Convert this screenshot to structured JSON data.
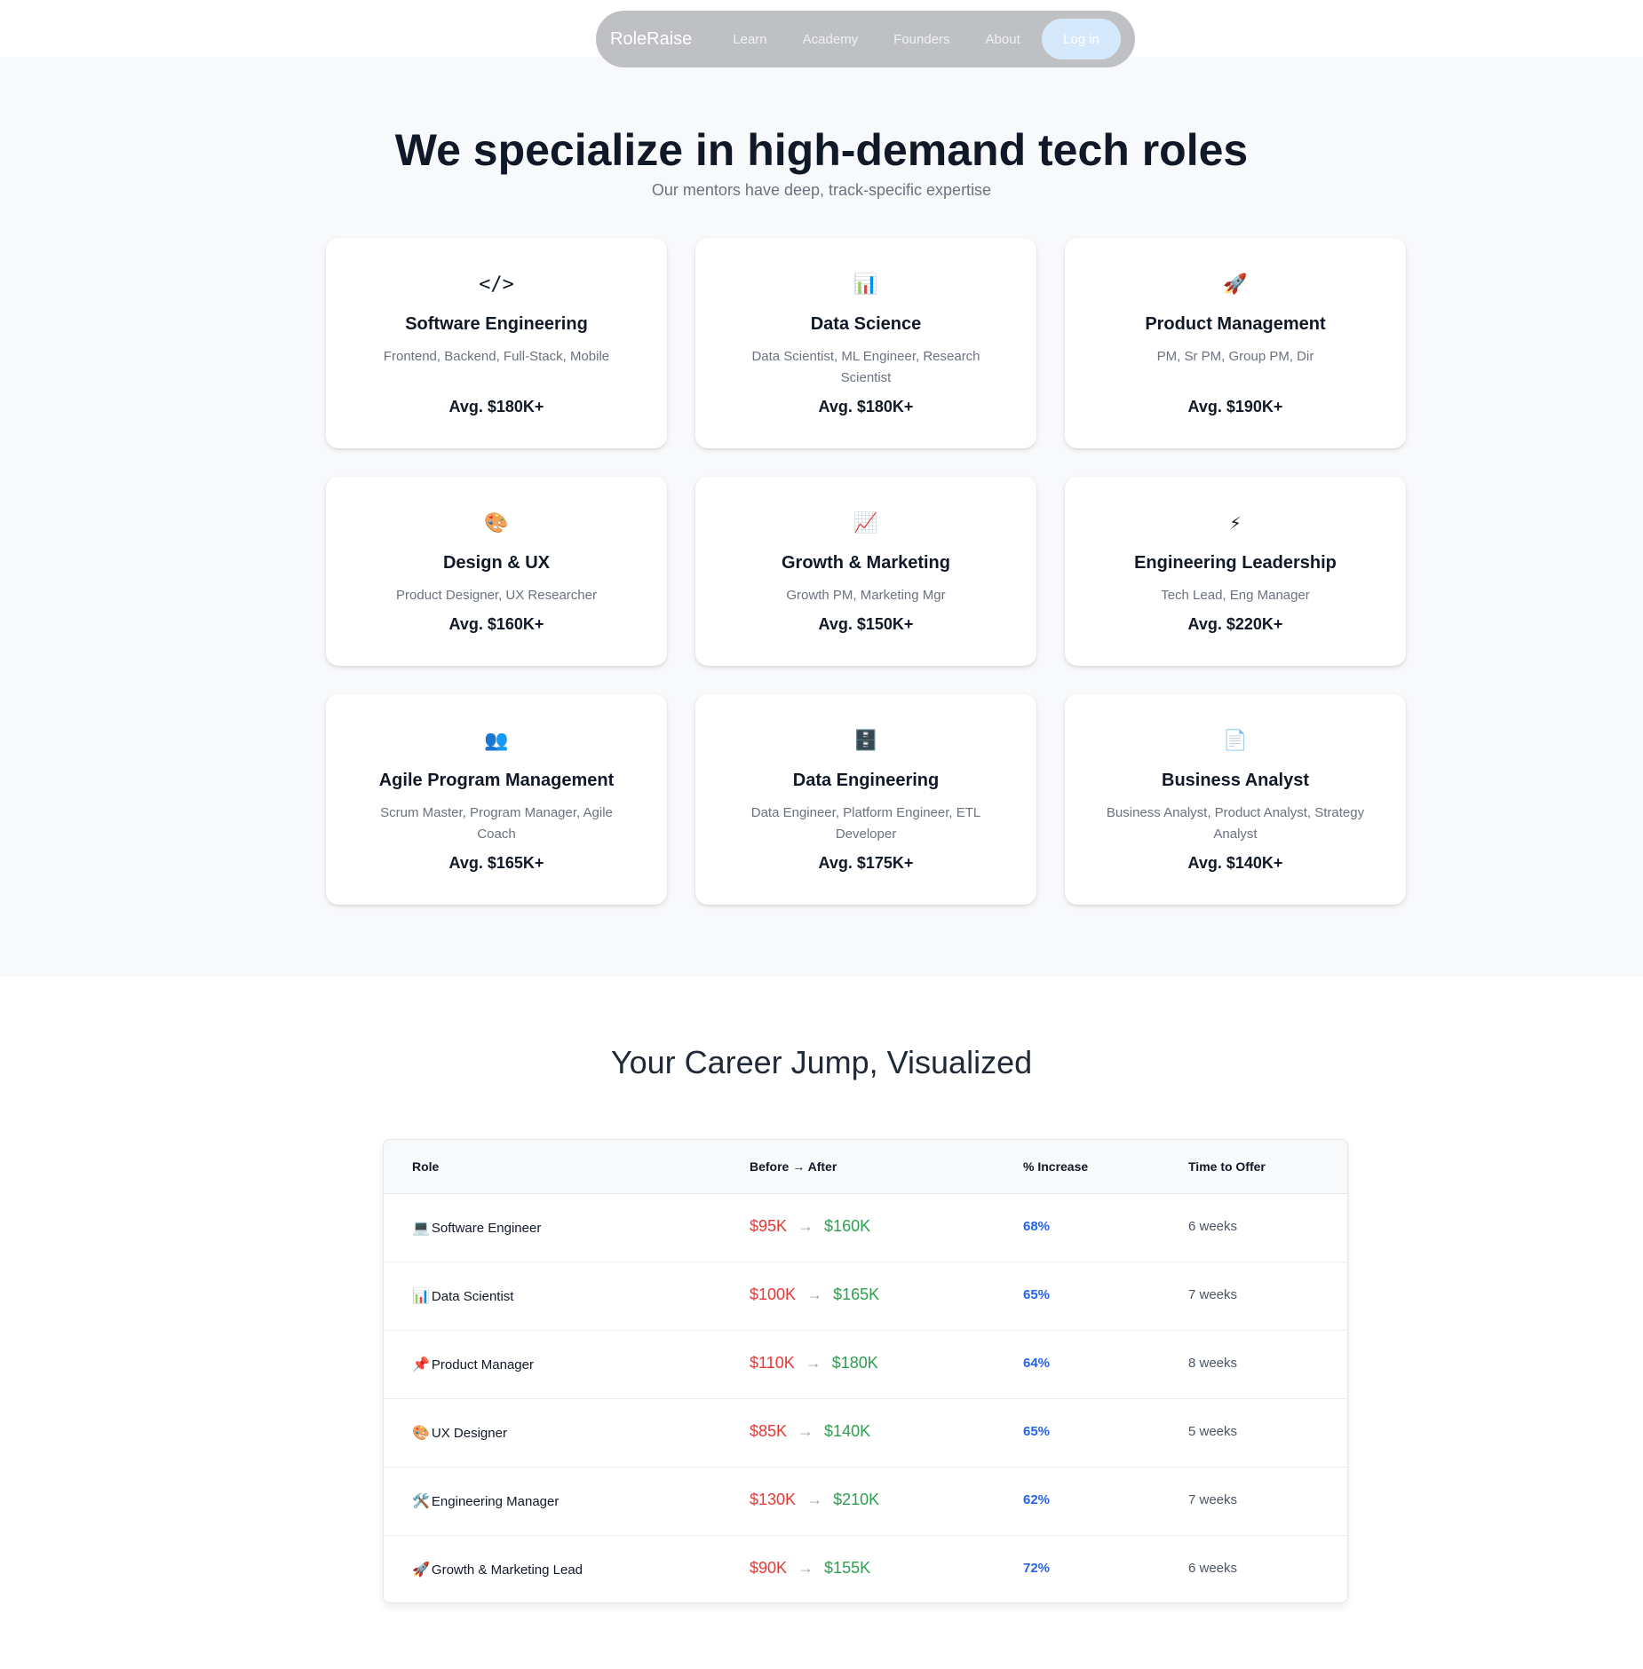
{
  "nav": {
    "brand": "RoleRaise",
    "links": [
      "Learn",
      "Academy",
      "Founders",
      "About"
    ],
    "login_label": "Log in"
  },
  "roles": {
    "title": "We specialize in high-demand tech roles",
    "subtitle": "Our mentors have deep, track-specific expertise",
    "cards": [
      {
        "icon": "</>",
        "title": "Software Engineering",
        "desc": "Frontend, Backend, Full-Stack, Mobile",
        "avg": "Avg. $180K+"
      },
      {
        "icon": "📊",
        "title": "Data Science",
        "desc": "Data Scientist, ML Engineer, Research Scientist",
        "avg": "Avg. $180K+"
      },
      {
        "icon": "🚀",
        "title": "Product Management",
        "desc": "PM, Sr PM, Group PM, Dir",
        "avg": "Avg. $190K+"
      },
      {
        "icon": "🎨",
        "title": "Design & UX",
        "desc": "Product Designer, UX Researcher",
        "avg": "Avg. $160K+"
      },
      {
        "icon": "📈",
        "title": "Growth & Marketing",
        "desc": "Growth PM, Marketing Mgr",
        "avg": "Avg. $150K+"
      },
      {
        "icon": "⚡",
        "title": "Engineering Leadership",
        "desc": "Tech Lead, Eng Manager",
        "avg": "Avg. $220K+"
      },
      {
        "icon": "👥",
        "title": "Agile Program Management",
        "desc": "Scrum Master, Program Manager, Agile Coach",
        "avg": "Avg. $165K+"
      },
      {
        "icon": "🗄️",
        "title": "Data Engineering",
        "desc": "Data Engineer, Platform Engineer, ETL Developer",
        "avg": "Avg. $175K+"
      },
      {
        "icon": "📄",
        "title": "Business Analyst",
        "desc": "Business Analyst, Product Analyst, Strategy Analyst",
        "avg": "Avg. $140K+"
      }
    ]
  },
  "career": {
    "title": "Your Career Jump, Visualized",
    "headers": {
      "role": "Role",
      "before_after": "Before → After",
      "increase": "% Increase",
      "time": "Time to Offer"
    },
    "arrow": "→",
    "rows": [
      {
        "emoji": "💻",
        "role": "Software Engineer",
        "before": "$95K",
        "after": "$160K",
        "increase": "68%",
        "time": "6 weeks"
      },
      {
        "emoji": "📊",
        "role": "Data Scientist",
        "before": "$100K",
        "after": "$165K",
        "increase": "65%",
        "time": "7 weeks"
      },
      {
        "emoji": "📌",
        "role": "Product Manager",
        "before": "$110K",
        "after": "$180K",
        "increase": "64%",
        "time": "8 weeks"
      },
      {
        "emoji": "🎨",
        "role": "UX Designer",
        "before": "$85K",
        "after": "$140K",
        "increase": "65%",
        "time": "5 weeks"
      },
      {
        "emoji": "🛠️",
        "role": "Engineering Manager",
        "before": "$130K",
        "after": "$210K",
        "increase": "62%",
        "time": "7 weeks"
      },
      {
        "emoji": "🚀",
        "role": "Growth & Marketing Lead",
        "before": "$90K",
        "after": "$155K",
        "increase": "72%",
        "time": "6 weeks"
      }
    ]
  }
}
